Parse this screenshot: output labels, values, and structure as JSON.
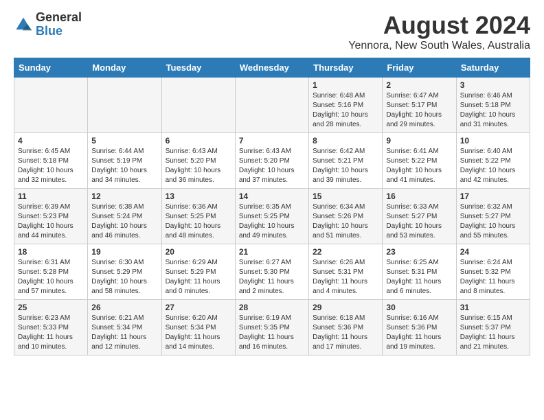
{
  "header": {
    "logo_general": "General",
    "logo_blue": "Blue",
    "month_title": "August 2024",
    "subtitle": "Yennora, New South Wales, Australia"
  },
  "weekdays": [
    "Sunday",
    "Monday",
    "Tuesday",
    "Wednesday",
    "Thursday",
    "Friday",
    "Saturday"
  ],
  "weeks": [
    [
      {
        "day": "",
        "info": ""
      },
      {
        "day": "",
        "info": ""
      },
      {
        "day": "",
        "info": ""
      },
      {
        "day": "",
        "info": ""
      },
      {
        "day": "1",
        "info": "Sunrise: 6:48 AM\nSunset: 5:16 PM\nDaylight: 10 hours\nand 28 minutes."
      },
      {
        "day": "2",
        "info": "Sunrise: 6:47 AM\nSunset: 5:17 PM\nDaylight: 10 hours\nand 29 minutes."
      },
      {
        "day": "3",
        "info": "Sunrise: 6:46 AM\nSunset: 5:18 PM\nDaylight: 10 hours\nand 31 minutes."
      }
    ],
    [
      {
        "day": "4",
        "info": "Sunrise: 6:45 AM\nSunset: 5:18 PM\nDaylight: 10 hours\nand 32 minutes."
      },
      {
        "day": "5",
        "info": "Sunrise: 6:44 AM\nSunset: 5:19 PM\nDaylight: 10 hours\nand 34 minutes."
      },
      {
        "day": "6",
        "info": "Sunrise: 6:43 AM\nSunset: 5:20 PM\nDaylight: 10 hours\nand 36 minutes."
      },
      {
        "day": "7",
        "info": "Sunrise: 6:43 AM\nSunset: 5:20 PM\nDaylight: 10 hours\nand 37 minutes."
      },
      {
        "day": "8",
        "info": "Sunrise: 6:42 AM\nSunset: 5:21 PM\nDaylight: 10 hours\nand 39 minutes."
      },
      {
        "day": "9",
        "info": "Sunrise: 6:41 AM\nSunset: 5:22 PM\nDaylight: 10 hours\nand 41 minutes."
      },
      {
        "day": "10",
        "info": "Sunrise: 6:40 AM\nSunset: 5:22 PM\nDaylight: 10 hours\nand 42 minutes."
      }
    ],
    [
      {
        "day": "11",
        "info": "Sunrise: 6:39 AM\nSunset: 5:23 PM\nDaylight: 10 hours\nand 44 minutes."
      },
      {
        "day": "12",
        "info": "Sunrise: 6:38 AM\nSunset: 5:24 PM\nDaylight: 10 hours\nand 46 minutes."
      },
      {
        "day": "13",
        "info": "Sunrise: 6:36 AM\nSunset: 5:25 PM\nDaylight: 10 hours\nand 48 minutes."
      },
      {
        "day": "14",
        "info": "Sunrise: 6:35 AM\nSunset: 5:25 PM\nDaylight: 10 hours\nand 49 minutes."
      },
      {
        "day": "15",
        "info": "Sunrise: 6:34 AM\nSunset: 5:26 PM\nDaylight: 10 hours\nand 51 minutes."
      },
      {
        "day": "16",
        "info": "Sunrise: 6:33 AM\nSunset: 5:27 PM\nDaylight: 10 hours\nand 53 minutes."
      },
      {
        "day": "17",
        "info": "Sunrise: 6:32 AM\nSunset: 5:27 PM\nDaylight: 10 hours\nand 55 minutes."
      }
    ],
    [
      {
        "day": "18",
        "info": "Sunrise: 6:31 AM\nSunset: 5:28 PM\nDaylight: 10 hours\nand 57 minutes."
      },
      {
        "day": "19",
        "info": "Sunrise: 6:30 AM\nSunset: 5:29 PM\nDaylight: 10 hours\nand 58 minutes."
      },
      {
        "day": "20",
        "info": "Sunrise: 6:29 AM\nSunset: 5:29 PM\nDaylight: 11 hours\nand 0 minutes."
      },
      {
        "day": "21",
        "info": "Sunrise: 6:27 AM\nSunset: 5:30 PM\nDaylight: 11 hours\nand 2 minutes."
      },
      {
        "day": "22",
        "info": "Sunrise: 6:26 AM\nSunset: 5:31 PM\nDaylight: 11 hours\nand 4 minutes."
      },
      {
        "day": "23",
        "info": "Sunrise: 6:25 AM\nSunset: 5:31 PM\nDaylight: 11 hours\nand 6 minutes."
      },
      {
        "day": "24",
        "info": "Sunrise: 6:24 AM\nSunset: 5:32 PM\nDaylight: 11 hours\nand 8 minutes."
      }
    ],
    [
      {
        "day": "25",
        "info": "Sunrise: 6:23 AM\nSunset: 5:33 PM\nDaylight: 11 hours\nand 10 minutes."
      },
      {
        "day": "26",
        "info": "Sunrise: 6:21 AM\nSunset: 5:34 PM\nDaylight: 11 hours\nand 12 minutes."
      },
      {
        "day": "27",
        "info": "Sunrise: 6:20 AM\nSunset: 5:34 PM\nDaylight: 11 hours\nand 14 minutes."
      },
      {
        "day": "28",
        "info": "Sunrise: 6:19 AM\nSunset: 5:35 PM\nDaylight: 11 hours\nand 16 minutes."
      },
      {
        "day": "29",
        "info": "Sunrise: 6:18 AM\nSunset: 5:36 PM\nDaylight: 11 hours\nand 17 minutes."
      },
      {
        "day": "30",
        "info": "Sunrise: 6:16 AM\nSunset: 5:36 PM\nDaylight: 11 hours\nand 19 minutes."
      },
      {
        "day": "31",
        "info": "Sunrise: 6:15 AM\nSunset: 5:37 PM\nDaylight: 11 hours\nand 21 minutes."
      }
    ]
  ]
}
